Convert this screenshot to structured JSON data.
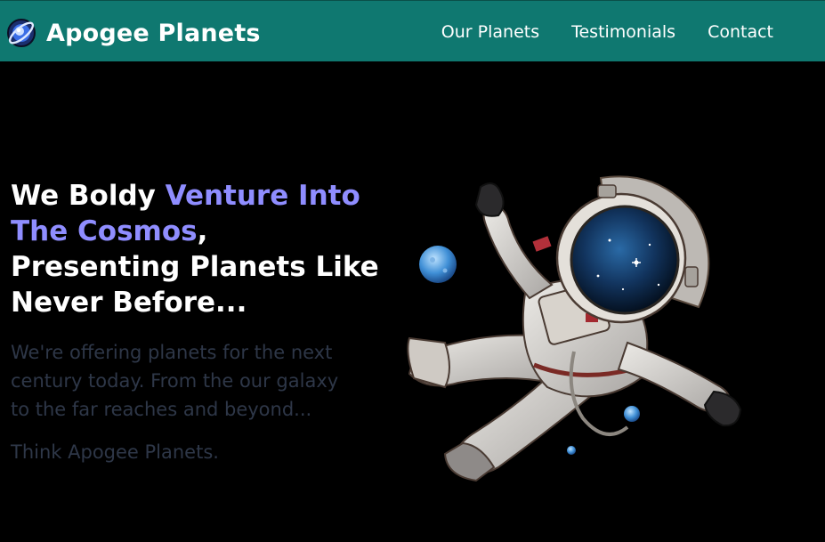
{
  "brand": {
    "name": "Apogee Planets",
    "logo_icon": "planet-logo-icon"
  },
  "nav": {
    "links": [
      {
        "label": "Our Planets"
      },
      {
        "label": "Testimonials"
      },
      {
        "label": "Contact"
      }
    ]
  },
  "hero": {
    "headline_part1": "We Boldy ",
    "headline_accent": "Venture Into The Cosmos",
    "headline_part2": ", Presenting Planets Like Never Before...",
    "subtext": "We're offering planets for the next century today. From the our galaxy to the far reaches and beyond...",
    "tagline": "Think Apogee Planets.",
    "illustration": "astronaut-illustration"
  },
  "colors": {
    "navbar": "#0f7870",
    "accent": "#8f8dff",
    "muted_text": "#2e3748",
    "background": "#000000"
  }
}
